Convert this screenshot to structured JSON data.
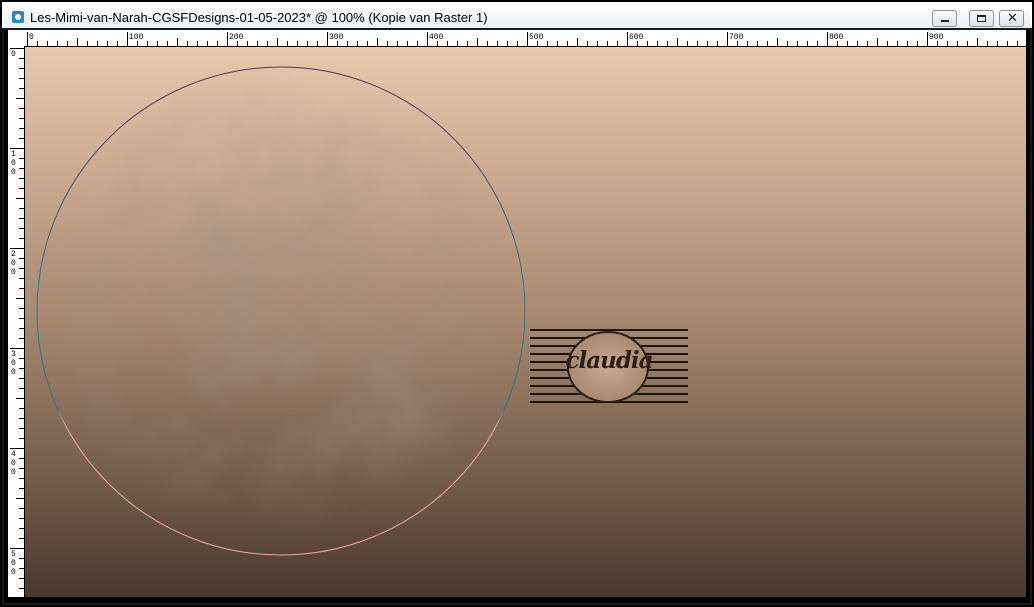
{
  "window": {
    "title": "Les-Mimi-van-Narah-CGSFDesigns-01-05-2023* @ 100% (Kopie van Raster 1)",
    "controls": [
      "minimize-icon",
      "maximize-icon",
      "close-icon"
    ],
    "close_glyph": "✕"
  },
  "rulers": {
    "top_labels": [
      "0",
      "100",
      "200",
      "300",
      "400",
      "500",
      "600",
      "700",
      "800",
      "900"
    ],
    "left_labels": [
      "0",
      "100",
      "200",
      "300",
      "400",
      "500"
    ],
    "unit_step": 100
  },
  "canvas": {
    "gradient_colors": [
      "#ebc8ac",
      "#cfae94",
      "#a6876f",
      "#745d4b",
      "#4a382e"
    ],
    "circle_stroke_colors": [
      "#5a2d4f",
      "#2a7b8c",
      "#f2a6a6"
    ]
  },
  "watermark": {
    "text": "claudia"
  },
  "colors": {
    "titlebar": "#ffffff",
    "window_border": "#000000"
  }
}
